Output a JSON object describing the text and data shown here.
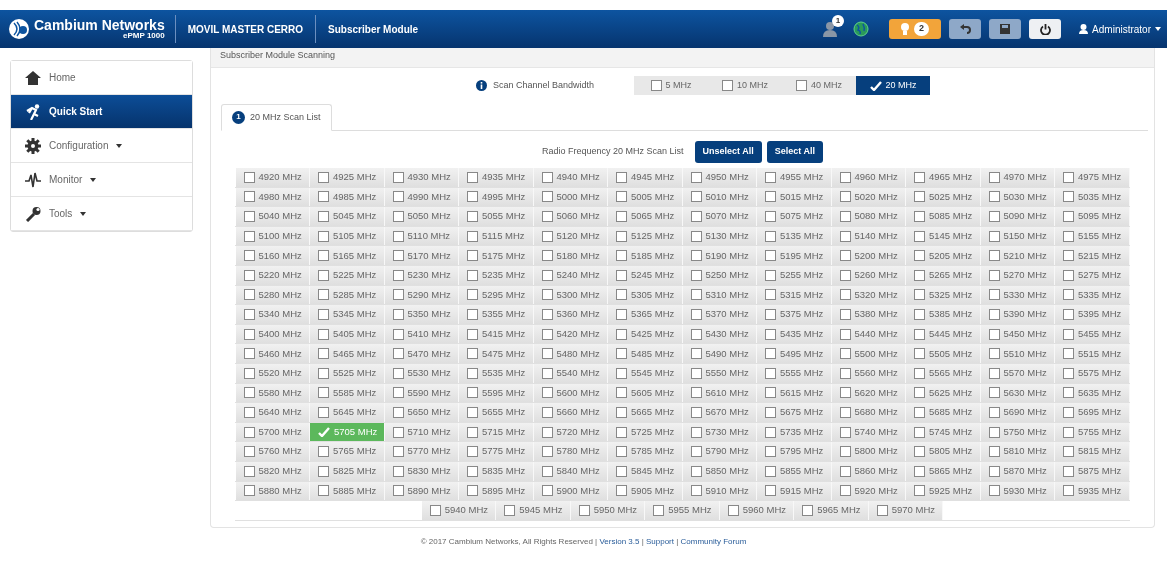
{
  "header": {
    "brand": "Cambium Networks",
    "product": "ePMP 1000",
    "device_name": "MOVIL MASTER CERRO",
    "mode": "Subscriber Module",
    "user_badge": "1",
    "alerts_count": "2",
    "user": "Administrator"
  },
  "sidebar": {
    "items": [
      {
        "label": "Home",
        "dropdown": false,
        "selected": false
      },
      {
        "label": "Quick Start",
        "dropdown": false,
        "selected": true
      },
      {
        "label": "Configuration",
        "dropdown": true,
        "selected": false
      },
      {
        "label": "Monitor",
        "dropdown": true,
        "selected": false
      },
      {
        "label": "Tools",
        "dropdown": true,
        "selected": false
      }
    ]
  },
  "panel": {
    "title": "Subscriber Module Scanning",
    "bandwidth_label": "Scan Channel Bandwidth",
    "bandwidths": [
      {
        "label": "5 MHz",
        "selected": false
      },
      {
        "label": "10 MHz",
        "selected": false
      },
      {
        "label": "40 MHz",
        "selected": false
      },
      {
        "label": "20 MHz",
        "selected": true
      }
    ],
    "tabs": [
      {
        "badge": "1",
        "label": "20 MHz Scan List",
        "selected": true
      }
    ],
    "list_label": "Radio Frequency 20 MHz Scan List",
    "buttons": [
      "Unselect All",
      "Select All"
    ],
    "frequency_rows": [
      [
        {
          "label": "4920 MHz",
          "selected": false
        },
        {
          "label": "4925 MHz",
          "selected": false
        },
        {
          "label": "4930 MHz",
          "selected": false
        },
        {
          "label": "4935 MHz",
          "selected": false
        },
        {
          "label": "4940 MHz",
          "selected": false
        },
        {
          "label": "4945 MHz",
          "selected": false
        },
        {
          "label": "4950 MHz",
          "selected": false
        },
        {
          "label": "4955 MHz",
          "selected": false
        },
        {
          "label": "4960 MHz",
          "selected": false
        },
        {
          "label": "4965 MHz",
          "selected": false
        },
        {
          "label": "4970 MHz",
          "selected": false
        },
        {
          "label": "4975 MHz",
          "selected": false
        }
      ],
      [
        {
          "label": "4980 MHz",
          "selected": false
        },
        {
          "label": "4985 MHz",
          "selected": false
        },
        {
          "label": "4990 MHz",
          "selected": false
        },
        {
          "label": "4995 MHz",
          "selected": false
        },
        {
          "label": "5000 MHz",
          "selected": false
        },
        {
          "label": "5005 MHz",
          "selected": false
        },
        {
          "label": "5010 MHz",
          "selected": false
        },
        {
          "label": "5015 MHz",
          "selected": false
        },
        {
          "label": "5020 MHz",
          "selected": false
        },
        {
          "label": "5025 MHz",
          "selected": false
        },
        {
          "label": "5030 MHz",
          "selected": false
        },
        {
          "label": "5035 MHz",
          "selected": false
        }
      ],
      [
        {
          "label": "5040 MHz",
          "selected": false
        },
        {
          "label": "5045 MHz",
          "selected": false
        },
        {
          "label": "5050 MHz",
          "selected": false
        },
        {
          "label": "5055 MHz",
          "selected": false
        },
        {
          "label": "5060 MHz",
          "selected": false
        },
        {
          "label": "5065 MHz",
          "selected": false
        },
        {
          "label": "5070 MHz",
          "selected": false
        },
        {
          "label": "5075 MHz",
          "selected": false
        },
        {
          "label": "5080 MHz",
          "selected": false
        },
        {
          "label": "5085 MHz",
          "selected": false
        },
        {
          "label": "5090 MHz",
          "selected": false
        },
        {
          "label": "5095 MHz",
          "selected": false
        }
      ],
      [
        {
          "label": "5100 MHz",
          "selected": false
        },
        {
          "label": "5105 MHz",
          "selected": false
        },
        {
          "label": "5110 MHz",
          "selected": false
        },
        {
          "label": "5115 MHz",
          "selected": false
        },
        {
          "label": "5120 MHz",
          "selected": false
        },
        {
          "label": "5125 MHz",
          "selected": false
        },
        {
          "label": "5130 MHz",
          "selected": false
        },
        {
          "label": "5135 MHz",
          "selected": false
        },
        {
          "label": "5140 MHz",
          "selected": false
        },
        {
          "label": "5145 MHz",
          "selected": false
        },
        {
          "label": "5150 MHz",
          "selected": false
        },
        {
          "label": "5155 MHz",
          "selected": false
        }
      ],
      [
        {
          "label": "5160 MHz",
          "selected": false
        },
        {
          "label": "5165 MHz",
          "selected": false
        },
        {
          "label": "5170 MHz",
          "selected": false
        },
        {
          "label": "5175 MHz",
          "selected": false
        },
        {
          "label": "5180 MHz",
          "selected": false
        },
        {
          "label": "5185 MHz",
          "selected": false
        },
        {
          "label": "5190 MHz",
          "selected": false
        },
        {
          "label": "5195 MHz",
          "selected": false
        },
        {
          "label": "5200 MHz",
          "selected": false
        },
        {
          "label": "5205 MHz",
          "selected": false
        },
        {
          "label": "5210 MHz",
          "selected": false
        },
        {
          "label": "5215 MHz",
          "selected": false
        }
      ],
      [
        {
          "label": "5220 MHz",
          "selected": false
        },
        {
          "label": "5225 MHz",
          "selected": false
        },
        {
          "label": "5230 MHz",
          "selected": false
        },
        {
          "label": "5235 MHz",
          "selected": false
        },
        {
          "label": "5240 MHz",
          "selected": false
        },
        {
          "label": "5245 MHz",
          "selected": false
        },
        {
          "label": "5250 MHz",
          "selected": false
        },
        {
          "label": "5255 MHz",
          "selected": false
        },
        {
          "label": "5260 MHz",
          "selected": false
        },
        {
          "label": "5265 MHz",
          "selected": false
        },
        {
          "label": "5270 MHz",
          "selected": false
        },
        {
          "label": "5275 MHz",
          "selected": false
        }
      ],
      [
        {
          "label": "5280 MHz",
          "selected": false
        },
        {
          "label": "5285 MHz",
          "selected": false
        },
        {
          "label": "5290 MHz",
          "selected": false
        },
        {
          "label": "5295 MHz",
          "selected": false
        },
        {
          "label": "5300 MHz",
          "selected": false
        },
        {
          "label": "5305 MHz",
          "selected": false
        },
        {
          "label": "5310 MHz",
          "selected": false
        },
        {
          "label": "5315 MHz",
          "selected": false
        },
        {
          "label": "5320 MHz",
          "selected": false
        },
        {
          "label": "5325 MHz",
          "selected": false
        },
        {
          "label": "5330 MHz",
          "selected": false
        },
        {
          "label": "5335 MHz",
          "selected": false
        }
      ],
      [
        {
          "label": "5340 MHz",
          "selected": false
        },
        {
          "label": "5345 MHz",
          "selected": false
        },
        {
          "label": "5350 MHz",
          "selected": false
        },
        {
          "label": "5355 MHz",
          "selected": false
        },
        {
          "label": "5360 MHz",
          "selected": false
        },
        {
          "label": "5365 MHz",
          "selected": false
        },
        {
          "label": "5370 MHz",
          "selected": false
        },
        {
          "label": "5375 MHz",
          "selected": false
        },
        {
          "label": "5380 MHz",
          "selected": false
        },
        {
          "label": "5385 MHz",
          "selected": false
        },
        {
          "label": "5390 MHz",
          "selected": false
        },
        {
          "label": "5395 MHz",
          "selected": false
        }
      ],
      [
        {
          "label": "5400 MHz",
          "selected": false
        },
        {
          "label": "5405 MHz",
          "selected": false
        },
        {
          "label": "5410 MHz",
          "selected": false
        },
        {
          "label": "5415 MHz",
          "selected": false
        },
        {
          "label": "5420 MHz",
          "selected": false
        },
        {
          "label": "5425 MHz",
          "selected": false
        },
        {
          "label": "5430 MHz",
          "selected": false
        },
        {
          "label": "5435 MHz",
          "selected": false
        },
        {
          "label": "5440 MHz",
          "selected": false
        },
        {
          "label": "5445 MHz",
          "selected": false
        },
        {
          "label": "5450 MHz",
          "selected": false
        },
        {
          "label": "5455 MHz",
          "selected": false
        }
      ],
      [
        {
          "label": "5460 MHz",
          "selected": false
        },
        {
          "label": "5465 MHz",
          "selected": false
        },
        {
          "label": "5470 MHz",
          "selected": false
        },
        {
          "label": "5475 MHz",
          "selected": false
        },
        {
          "label": "5480 MHz",
          "selected": false
        },
        {
          "label": "5485 MHz",
          "selected": false
        },
        {
          "label": "5490 MHz",
          "selected": false
        },
        {
          "label": "5495 MHz",
          "selected": false
        },
        {
          "label": "5500 MHz",
          "selected": false
        },
        {
          "label": "5505 MHz",
          "selected": false
        },
        {
          "label": "5510 MHz",
          "selected": false
        },
        {
          "label": "5515 MHz",
          "selected": false
        }
      ],
      [
        {
          "label": "5520 MHz",
          "selected": false
        },
        {
          "label": "5525 MHz",
          "selected": false
        },
        {
          "label": "5530 MHz",
          "selected": false
        },
        {
          "label": "5535 MHz",
          "selected": false
        },
        {
          "label": "5540 MHz",
          "selected": false
        },
        {
          "label": "5545 MHz",
          "selected": false
        },
        {
          "label": "5550 MHz",
          "selected": false
        },
        {
          "label": "5555 MHz",
          "selected": false
        },
        {
          "label": "5560 MHz",
          "selected": false
        },
        {
          "label": "5565 MHz",
          "selected": false
        },
        {
          "label": "5570 MHz",
          "selected": false
        },
        {
          "label": "5575 MHz",
          "selected": false
        }
      ],
      [
        {
          "label": "5580 MHz",
          "selected": false
        },
        {
          "label": "5585 MHz",
          "selected": false
        },
        {
          "label": "5590 MHz",
          "selected": false
        },
        {
          "label": "5595 MHz",
          "selected": false
        },
        {
          "label": "5600 MHz",
          "selected": false
        },
        {
          "label": "5605 MHz",
          "selected": false
        },
        {
          "label": "5610 MHz",
          "selected": false
        },
        {
          "label": "5615 MHz",
          "selected": false
        },
        {
          "label": "5620 MHz",
          "selected": false
        },
        {
          "label": "5625 MHz",
          "selected": false
        },
        {
          "label": "5630 MHz",
          "selected": false
        },
        {
          "label": "5635 MHz",
          "selected": false
        }
      ],
      [
        {
          "label": "5640 MHz",
          "selected": false
        },
        {
          "label": "5645 MHz",
          "selected": false
        },
        {
          "label": "5650 MHz",
          "selected": false
        },
        {
          "label": "5655 MHz",
          "selected": false
        },
        {
          "label": "5660 MHz",
          "selected": false
        },
        {
          "label": "5665 MHz",
          "selected": false
        },
        {
          "label": "5670 MHz",
          "selected": false
        },
        {
          "label": "5675 MHz",
          "selected": false
        },
        {
          "label": "5680 MHz",
          "selected": false
        },
        {
          "label": "5685 MHz",
          "selected": false
        },
        {
          "label": "5690 MHz",
          "selected": false
        },
        {
          "label": "5695 MHz",
          "selected": false
        }
      ],
      [
        {
          "label": "5700 MHz",
          "selected": false
        },
        {
          "label": "5705 MHz",
          "selected": true
        },
        {
          "label": "5710 MHz",
          "selected": false
        },
        {
          "label": "5715 MHz",
          "selected": false
        },
        {
          "label": "5720 MHz",
          "selected": false
        },
        {
          "label": "5725 MHz",
          "selected": false
        },
        {
          "label": "5730 MHz",
          "selected": false
        },
        {
          "label": "5735 MHz",
          "selected": false
        },
        {
          "label": "5740 MHz",
          "selected": false
        },
        {
          "label": "5745 MHz",
          "selected": false
        },
        {
          "label": "5750 MHz",
          "selected": false
        },
        {
          "label": "5755 MHz",
          "selected": false
        }
      ],
      [
        {
          "label": "5760 MHz",
          "selected": false
        },
        {
          "label": "5765 MHz",
          "selected": false
        },
        {
          "label": "5770 MHz",
          "selected": false
        },
        {
          "label": "5775 MHz",
          "selected": false
        },
        {
          "label": "5780 MHz",
          "selected": false
        },
        {
          "label": "5785 MHz",
          "selected": false
        },
        {
          "label": "5790 MHz",
          "selected": false
        },
        {
          "label": "5795 MHz",
          "selected": false
        },
        {
          "label": "5800 MHz",
          "selected": false
        },
        {
          "label": "5805 MHz",
          "selected": false
        },
        {
          "label": "5810 MHz",
          "selected": false
        },
        {
          "label": "5815 MHz",
          "selected": false
        }
      ],
      [
        {
          "label": "5820 MHz",
          "selected": false
        },
        {
          "label": "5825 MHz",
          "selected": false
        },
        {
          "label": "5830 MHz",
          "selected": false
        },
        {
          "label": "5835 MHz",
          "selected": false
        },
        {
          "label": "5840 MHz",
          "selected": false
        },
        {
          "label": "5845 MHz",
          "selected": false
        },
        {
          "label": "5850 MHz",
          "selected": false
        },
        {
          "label": "5855 MHz",
          "selected": false
        },
        {
          "label": "5860 MHz",
          "selected": false
        },
        {
          "label": "5865 MHz",
          "selected": false
        },
        {
          "label": "5870 MHz",
          "selected": false
        },
        {
          "label": "5875 MHz",
          "selected": false
        }
      ],
      [
        {
          "label": "5880 MHz",
          "selected": false
        },
        {
          "label": "5885 MHz",
          "selected": false
        },
        {
          "label": "5890 MHz",
          "selected": false
        },
        {
          "label": "5895 MHz",
          "selected": false
        },
        {
          "label": "5900 MHz",
          "selected": false
        },
        {
          "label": "5905 MHz",
          "selected": false
        },
        {
          "label": "5910 MHz",
          "selected": false
        },
        {
          "label": "5915 MHz",
          "selected": false
        },
        {
          "label": "5920 MHz",
          "selected": false
        },
        {
          "label": "5925 MHz",
          "selected": false
        },
        {
          "label": "5930 MHz",
          "selected": false
        },
        {
          "label": "5935 MHz",
          "selected": false
        }
      ],
      [
        {
          "label": "5940 MHz",
          "selected": false
        },
        {
          "label": "5945 MHz",
          "selected": false
        },
        {
          "label": "5950 MHz",
          "selected": false
        },
        {
          "label": "5955 MHz",
          "selected": false
        },
        {
          "label": "5960 MHz",
          "selected": false
        },
        {
          "label": "5965 MHz",
          "selected": false
        },
        {
          "label": "5970 MHz",
          "selected": false
        }
      ]
    ]
  },
  "footer": {
    "copyright": "© 2017 Cambium Networks, All Rights Reserved",
    "separators": [
      "|",
      "|",
      "|"
    ],
    "links": [
      "Version 3.5",
      "Support",
      "Community Forum"
    ]
  }
}
